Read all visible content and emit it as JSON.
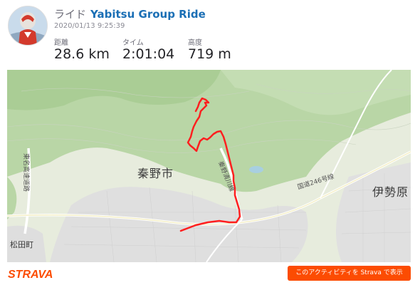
{
  "header": {
    "avatar_icon": "rider-avatar-icon",
    "activity_type": "ライド",
    "activity_name": "Yabitsu Group Ride",
    "timestamp": "2020/01/13 9:25:39",
    "stats": [
      {
        "label": "距離",
        "value": "28.6 km"
      },
      {
        "label": "タイム",
        "value": "2:01:04"
      },
      {
        "label": "高度",
        "value": "719 m"
      }
    ]
  },
  "map": {
    "labels": {
      "city": "秦野市",
      "isehara": "伊勢原",
      "matsuda": "松田町",
      "route246": "国道246号線",
      "rapid": "秦野清川線",
      "tomei": "東名高速道路"
    },
    "route_color": "#ff1f1f",
    "land_color": "#e7ecdd",
    "forest_color": "#b9d6a6",
    "urban_color": "#dfdfdf"
  },
  "footer": {
    "brand": "STRAVA",
    "brand_color": "#fc4c02",
    "open_button": "このアクティビティを Strava で表示"
  }
}
